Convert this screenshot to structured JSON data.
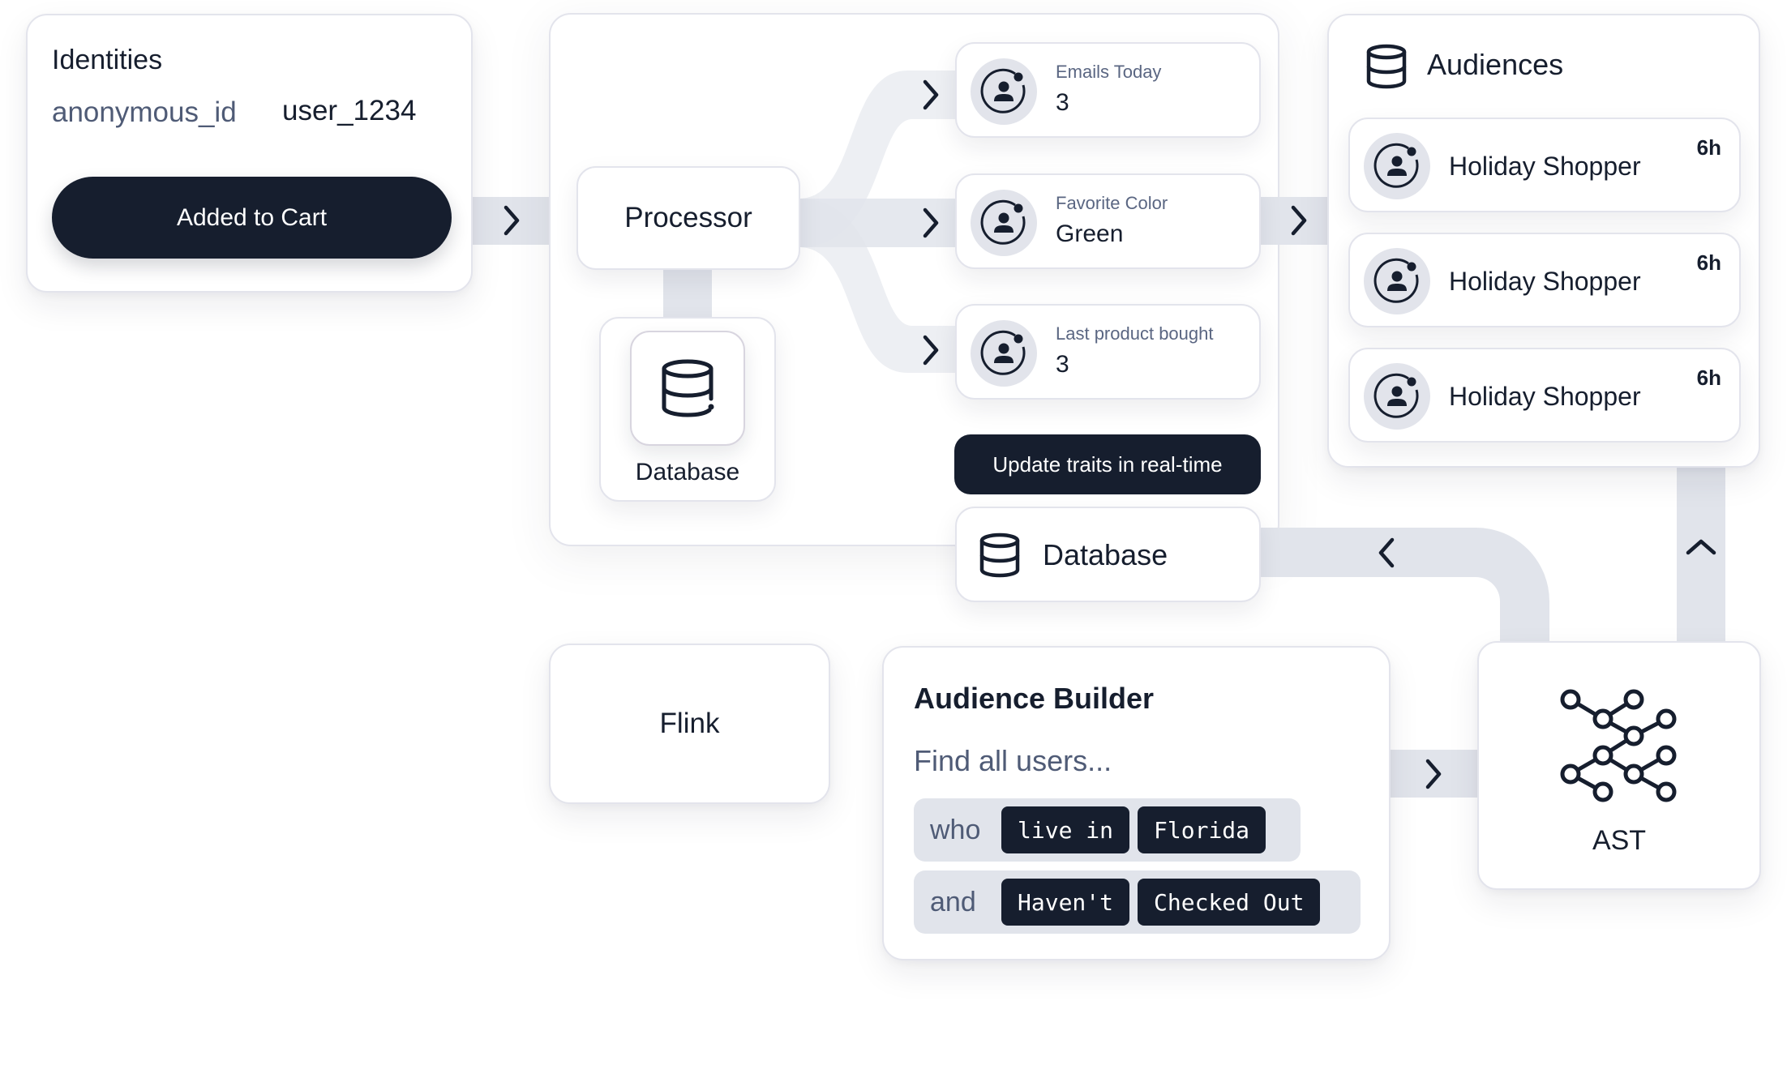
{
  "identities": {
    "title": "Identities",
    "anonymous_id_label": "anonymous_id",
    "user_id_value": "user_1234",
    "event_button": "Added to Cart"
  },
  "processor": {
    "label": "Processor",
    "database_label": "Database",
    "traits": [
      {
        "label": "Emails Today",
        "value": "3",
        "icon": "user-circle-icon"
      },
      {
        "label": "Favorite Color",
        "value": "Green",
        "icon": "user-circle-icon"
      },
      {
        "label": "Last product bought",
        "value": "3",
        "icon": "user-circle-icon"
      }
    ],
    "update_button": "Update traits in real-time",
    "database_row_label": "Database"
  },
  "audiences": {
    "title": "Audiences",
    "icon": "database-icon",
    "items": [
      {
        "name": "Holiday Shopper",
        "age": "6h"
      },
      {
        "name": "Holiday Shopper",
        "age": "6h"
      },
      {
        "name": "Holiday Shopper",
        "age": "6h"
      }
    ]
  },
  "flink": {
    "label": "Flink"
  },
  "audience_builder": {
    "title": "Audience Builder",
    "subtitle": "Find all users...",
    "conditions": [
      {
        "keyword": "who",
        "chips": [
          "live in",
          "Florida"
        ]
      },
      {
        "keyword": "and",
        "chips": [
          "Haven't",
          "Checked Out"
        ]
      }
    ]
  },
  "ast": {
    "label": "AST",
    "icon": "graph-nodes-icon"
  },
  "connectors": {
    "identities_to_processor": "chevron-right",
    "processor_to_traits": [
      "chevron-right",
      "chevron-right",
      "chevron-right"
    ],
    "traits_to_audiences": "chevron-right",
    "ast_to_database": "chevron-left",
    "ast_to_audiences": "chevron-up",
    "builder_to_ast": "chevron-right"
  },
  "colors": {
    "ink": "#161e2e",
    "muted": "#4f5b76",
    "connector": "#e1e4eb",
    "card_border": "#e3e4ec"
  }
}
